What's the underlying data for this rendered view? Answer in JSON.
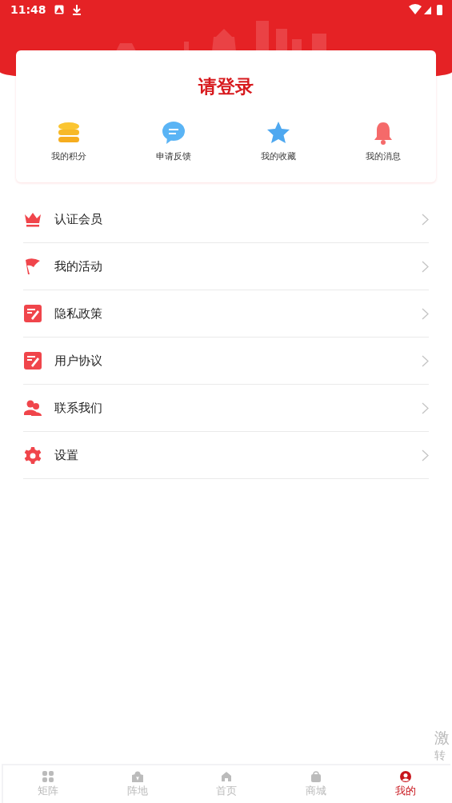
{
  "status_bar": {
    "time": "11:48"
  },
  "login_card": {
    "title": "请登录",
    "actions": [
      {
        "kind": "coins",
        "label": "我的积分"
      },
      {
        "kind": "chat",
        "label": "申请反馈"
      },
      {
        "kind": "star",
        "label": "我的收藏"
      },
      {
        "kind": "bell",
        "label": "我的消息"
      }
    ]
  },
  "menu": [
    {
      "kind": "crown",
      "label": "认证会员"
    },
    {
      "kind": "flag",
      "label": "我的活动"
    },
    {
      "kind": "document",
      "label": "隐私政策"
    },
    {
      "kind": "document",
      "label": "用户协议"
    },
    {
      "kind": "people",
      "label": "联系我们"
    },
    {
      "kind": "gear",
      "label": "设置"
    }
  ],
  "floating_texts": [
    "激",
    "转"
  ],
  "bottom_nav": [
    {
      "kind": "grid",
      "label": "矩阵",
      "selected": false
    },
    {
      "kind": "map",
      "label": "阵地",
      "selected": false
    },
    {
      "kind": "home",
      "label": "首页",
      "selected": false
    },
    {
      "kind": "bag",
      "label": "商城",
      "selected": false
    },
    {
      "kind": "user",
      "label": "我的",
      "selected": true
    }
  ]
}
